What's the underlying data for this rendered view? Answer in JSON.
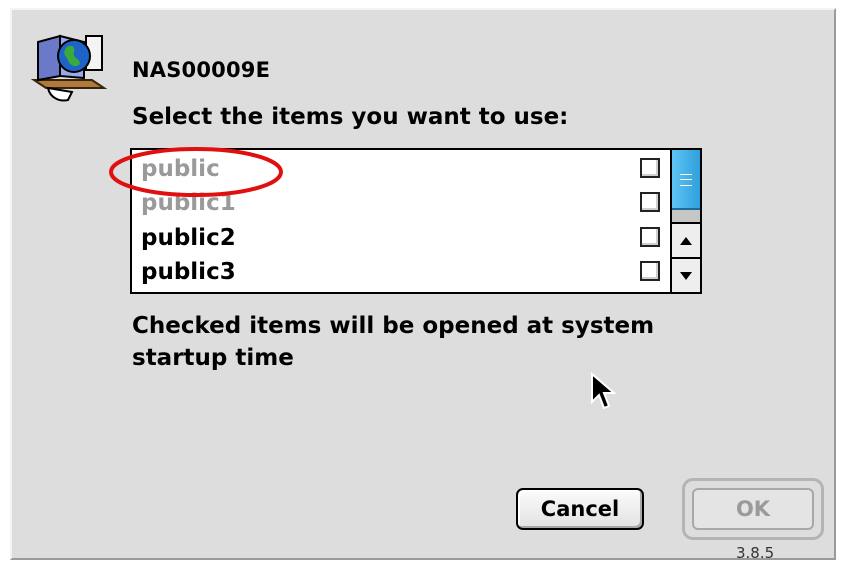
{
  "dialog": {
    "server_name": "NAS00009E",
    "prompt": "Select the items you want to use:",
    "footnote_line1": "Checked items will be opened at system",
    "footnote_line2": "startup time",
    "version": "3.8.5"
  },
  "list": {
    "items": [
      {
        "label": "public",
        "checked": false,
        "dimmed": true
      },
      {
        "label": "public1",
        "checked": false,
        "dimmed": true
      },
      {
        "label": "public2",
        "checked": false,
        "dimmed": false
      },
      {
        "label": "public3",
        "checked": false,
        "dimmed": false
      }
    ]
  },
  "buttons": {
    "cancel_label": "Cancel",
    "ok_label": "OK"
  },
  "icons": {
    "server": "file-server-globe-icon",
    "scroll_up": "arrow-up-icon",
    "scroll_down": "arrow-down-icon",
    "cursor": "mouse-pointer-icon"
  },
  "colors": {
    "dialog_bg": "#dddddd",
    "annotation": "#e01010",
    "scroll_thumb": "#3fb0e8",
    "dimmed_text": "#9a9a9a"
  }
}
